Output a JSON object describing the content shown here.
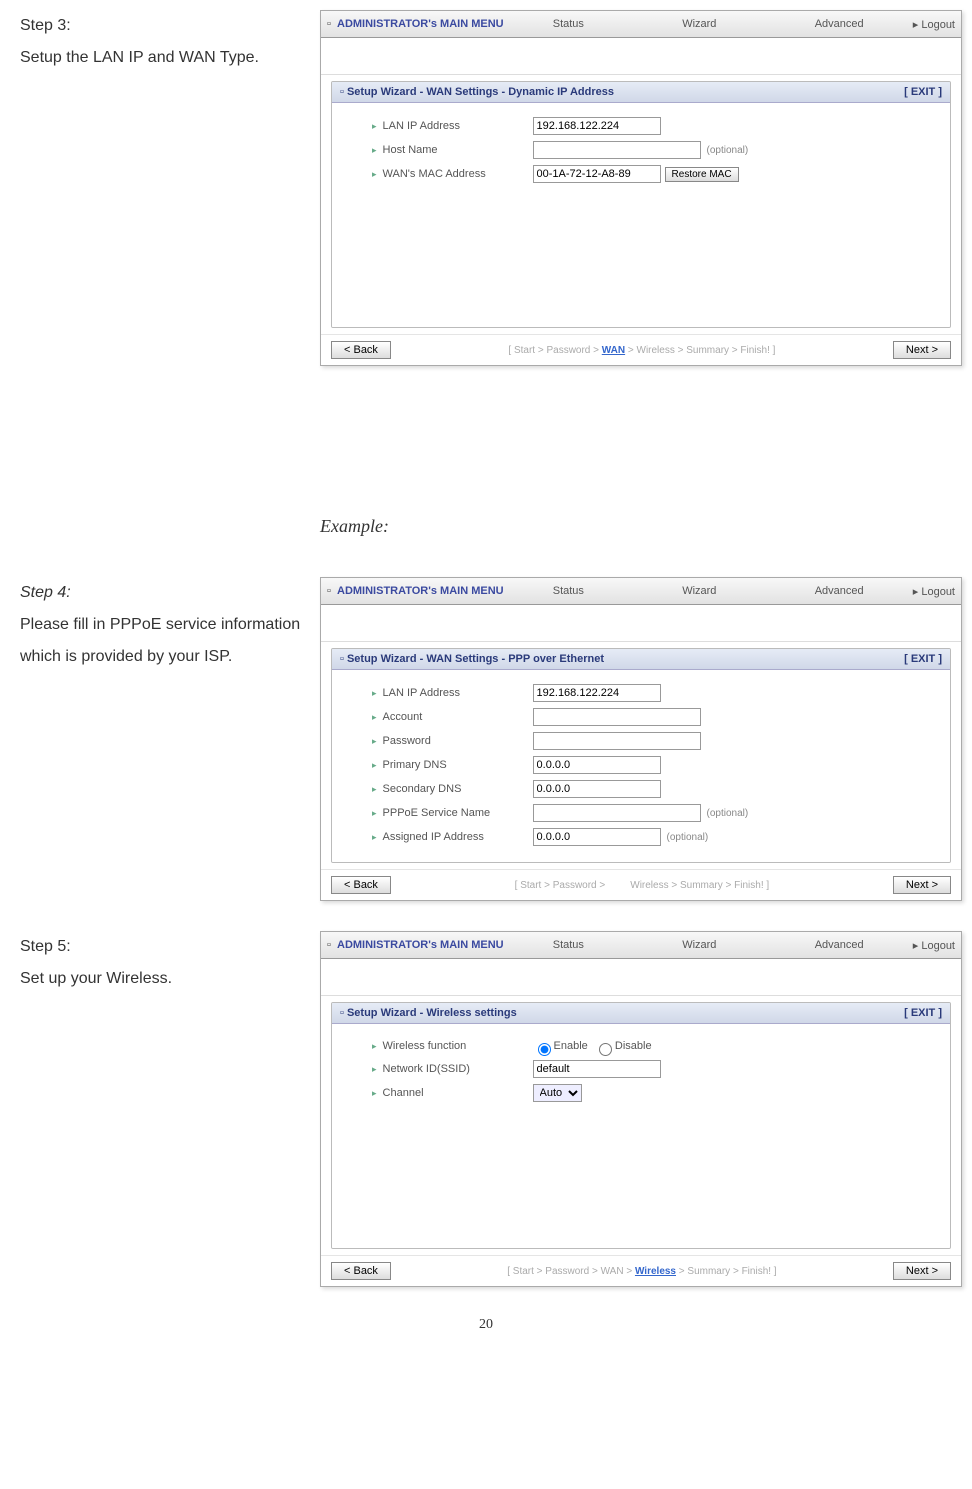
{
  "steps": {
    "s3": {
      "title": "Step 3:",
      "desc": "Setup the LAN IP and WAN Type."
    },
    "example": "Example:",
    "s4": {
      "title": "Step 4:",
      "desc": "Please fill in PPPoE service information which is provided by your ISP."
    },
    "s5": {
      "title": "Step 5:",
      "desc": "Set up your Wireless."
    }
  },
  "menu": {
    "main": "ADMINISTRATOR's MAIN MENU",
    "status": "Status",
    "wizard": "Wizard",
    "advanced": "Advanced",
    "logout": "▸ Logout"
  },
  "panel1": {
    "title": "Setup Wizard - WAN Settings - Dynamic IP Address",
    "exit": "[ EXIT ]",
    "rows": {
      "lanip": {
        "label": "LAN IP Address",
        "value": "192.168.122.224"
      },
      "host": {
        "label": "Host Name",
        "value": "",
        "hint": "(optional)"
      },
      "mac": {
        "label": "WAN's MAC Address",
        "value": "00-1A-72-12-A8-89",
        "btn": "Restore MAC"
      }
    },
    "crumbs": {
      "prefix1": "[ Start > Password > ",
      "active": "WAN",
      "suffix": " > Wireless > Summary > Finish! ]"
    }
  },
  "panel2": {
    "title": "Setup Wizard - WAN Settings - PPP over Ethernet",
    "exit": "[ EXIT ]",
    "rows": {
      "lanip": {
        "label": "LAN IP Address",
        "value": "192.168.122.224"
      },
      "account": {
        "label": "Account",
        "value": ""
      },
      "password": {
        "label": "Password",
        "value": ""
      },
      "pdns": {
        "label": "Primary DNS",
        "value": "0.0.0.0"
      },
      "sdns": {
        "label": "Secondary DNS",
        "value": "0.0.0.0"
      },
      "svc": {
        "label": "PPPoE Service Name",
        "value": "",
        "hint": "(optional)"
      },
      "aip": {
        "label": "Assigned IP Address",
        "value": "0.0.0.0",
        "hint": "(optional)"
      }
    },
    "crumbs": {
      "prefix1": "[ Start > Password > ",
      "gap": "",
      "suffix": "Wireless > Summary > Finish! ]"
    }
  },
  "panel3": {
    "title": "Setup Wizard - Wireless settings",
    "exit": "[ EXIT ]",
    "rows": {
      "func": {
        "label": "Wireless function",
        "enable": "Enable",
        "disable": "Disable"
      },
      "ssid": {
        "label": "Network ID(SSID)",
        "value": "default"
      },
      "chan": {
        "label": "Channel",
        "value": "Auto"
      }
    },
    "crumbs": {
      "prefix1": "[ Start > Password > WAN > ",
      "active": "Wireless",
      "suffix": " > Summary > Finish! ]"
    }
  },
  "buttons": {
    "back": "< Back",
    "next": "Next >"
  },
  "page_number": "20"
}
